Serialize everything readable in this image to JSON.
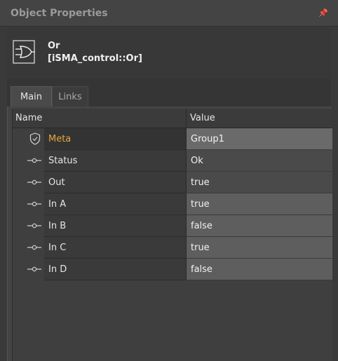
{
  "panel": {
    "title": "Object Properties",
    "pin_icon": "pin-icon"
  },
  "object": {
    "name": "Or",
    "type": "[iSMA_control::Or]",
    "icon": "or-gate-icon"
  },
  "tabs": [
    {
      "label": "Main",
      "active": true
    },
    {
      "label": "Links",
      "active": false
    }
  ],
  "table": {
    "columns": {
      "name": "Name",
      "value": "Value"
    },
    "rows": [
      {
        "icon": "shield-icon",
        "name": "Meta",
        "value": "Group1"
      },
      {
        "icon": "slot-icon",
        "name": "Status",
        "value": "Ok"
      },
      {
        "icon": "slot-icon",
        "name": "Out",
        "value": "true"
      },
      {
        "icon": "slot-icon",
        "name": "In A",
        "value": "true"
      },
      {
        "icon": "slot-icon",
        "name": "In B",
        "value": "false"
      },
      {
        "icon": "slot-icon",
        "name": "In C",
        "value": "true"
      },
      {
        "icon": "slot-icon",
        "name": "In D",
        "value": "false"
      }
    ]
  },
  "colors": {
    "meta_label": "#e8a640",
    "background": "#3a3a3a"
  }
}
